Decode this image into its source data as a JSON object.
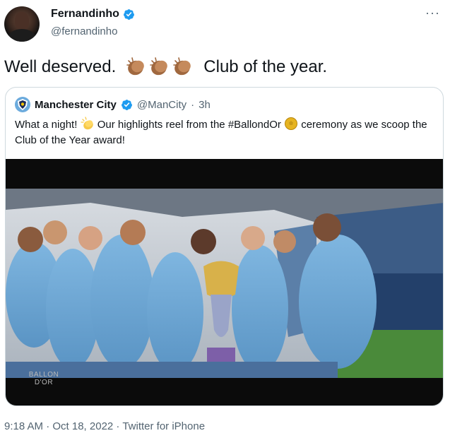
{
  "author": {
    "display_name": "Fernandinho",
    "handle": "@fernandinho",
    "verified": true
  },
  "tweet": {
    "text_before": "Well deserved.",
    "emoji": "clapping-hands-x3",
    "text_after": "Club of the year."
  },
  "quoted": {
    "display_name": "Manchester City",
    "handle": "@ManCity",
    "separator": "·",
    "time": "3h",
    "text_1": "What a night!",
    "text_2": "Our highlights reel from the #BallondOr",
    "text_3": "ceremony as we scoop the Club of the Year award!",
    "media": {
      "logo_line1": "BALLON",
      "logo_line2": "D'OR"
    }
  },
  "meta": {
    "time": "9:18 AM",
    "date": "Oct 18, 2022",
    "source": "Twitter for iPhone",
    "full": "9:18 AM · Oct 18, 2022 · Twitter for iPhone"
  },
  "icons": {
    "verified": "verified-badge-icon",
    "more": "more-options-icon",
    "clap": "clapping-hands-icon",
    "wave": "clap-emoji-icon",
    "ball": "golden-ball-icon"
  },
  "colors": {
    "verified_blue": "#1d9bf0",
    "mancity_blue": "#6cabdd",
    "secondary_text": "#536471",
    "border": "#cfd9de"
  }
}
